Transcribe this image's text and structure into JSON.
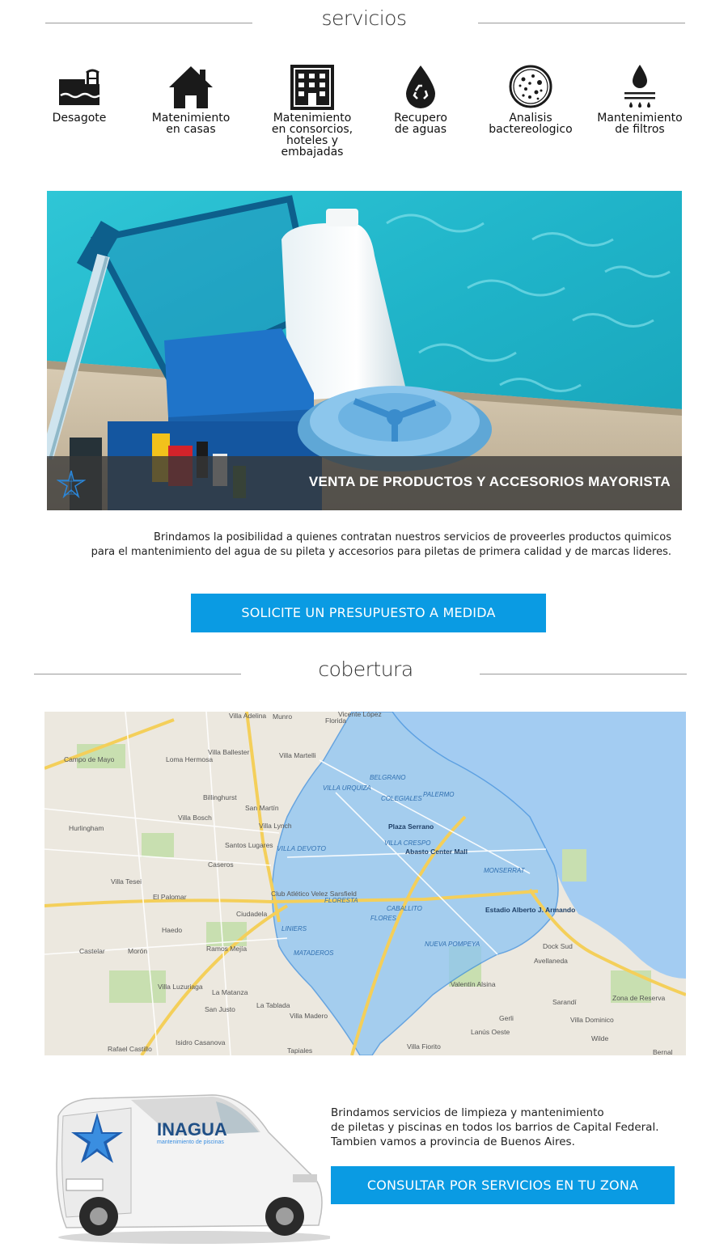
{
  "services_section": {
    "title": "servicios",
    "items": [
      {
        "icon": "pool-drain-icon",
        "line1": "Desagote",
        "line2": "",
        "line3": "",
        "line4": ""
      },
      {
        "icon": "house-icon",
        "line1": "Matenimiento",
        "line2": "en casas",
        "line3": "",
        "line4": ""
      },
      {
        "icon": "building-icon",
        "line1": "Matenimiento",
        "line2": "en consorcios,",
        "line3": "hoteles y",
        "line4": "embajadas"
      },
      {
        "icon": "recycle-drop-icon",
        "line1": "Recupero",
        "line2": "de aguas",
        "line3": "",
        "line4": ""
      },
      {
        "icon": "bacteria-dish-icon",
        "line1": "Analisis",
        "line2": "bactereologico",
        "line3": "",
        "line4": ""
      },
      {
        "icon": "filter-drop-icon",
        "line1": "Mantenimiento",
        "line2": "de filtros",
        "line3": "",
        "line4": ""
      }
    ]
  },
  "hero": {
    "caption": "VENTA DE PRODUCTOS Y ACCESORIOS MAYORISTA"
  },
  "products": {
    "line1": "Brindamos la posibilidad a quienes contratan nuestros servicios de proveerles productos quimicos",
    "line2": "para el mantenimiento del agua de su pileta y accesorios para piletas de primera calidad y de marcas lideres.",
    "button": "SOLICITE UN PRESUPUESTO A MEDIDA"
  },
  "coverage_section": {
    "title": "cobertura"
  },
  "map": {
    "labels": {
      "florida": "Florida",
      "vicente_lopez": "Vicente López",
      "villa_adelina": "Villa Adelina",
      "munro": "Munro",
      "villa_ballester": "Villa Ballester",
      "villa_martelli": "Villa Martelli",
      "campo_de_mayo": "Campo de Mayo",
      "loma_hermosa": "Loma Hermosa",
      "billinghurst": "Billinghurst",
      "san_martin": "San Martín",
      "villa_bosch": "Villa Bosch",
      "villa_lynch": "Villa Lynch",
      "hurlingham": "Hurlingham",
      "santos_lugares": "Santos Lugares",
      "villa_devoto": "VILLA DEVOTO",
      "caseros": "Caseros",
      "villa_tesei": "Villa Tesei",
      "el_palomar": "El Palomar",
      "ciudadela": "Ciudadela",
      "haedo": "Haedo",
      "moron": "Morón",
      "castelar": "Castelar",
      "ramos_mejia": "Ramos Mejía",
      "villa_luzuriaga": "Villa Luzuriaga",
      "la_matanza": "La Matanza",
      "san_justo": "San Justo",
      "la_tablada": "La Tablada",
      "villa_madero": "Villa Madero",
      "isidro_casanova": "Isidro Casanova",
      "rafael_castillo": "Rafael Castillo",
      "tapiales": "Tapiales",
      "belgrano": "BELGRANO",
      "villa_urquiza": "VILLA URQUIZA",
      "colegiales": "COLEGIALES",
      "palermo": "PALERMO",
      "plaza_serrano": "Plaza Serrano",
      "villa_crespo": "VILLA CRESPO",
      "abasto": "Abasto Center Mall",
      "monserrat": "MONSERRAT",
      "floresta": "FLORESTA",
      "caballito": "CABALLITO",
      "flores": "FLORES",
      "liniers": "LINIERS",
      "mataderos": "MATADEROS",
      "nueva_pompeya": "NUEVA POMPEYA",
      "estadio": "Estadio Alberto J. Armando",
      "dock_sud": "Dock Sud",
      "avellaneda": "Avellaneda",
      "valentin_alsina": "Valentín Alsina",
      "gerli": "Gerli",
      "lanus_oeste": "Lanús Oeste",
      "sarandi": "Sarandí",
      "villa_dominico": "Villa Dominico",
      "wilde": "Wilde",
      "villa_fiorito": "Villa Fiorito",
      "bernal": "Bernal",
      "zona_de_reserva": "Zona de Reserva",
      "club_velez": "Club Atlético Velez Sarsfield"
    }
  },
  "coverage": {
    "line1": "Brindamos servicios de limpieza y mantenimiento",
    "line2": "de piletas y piscinas en todos los barrios de Capital Federal.",
    "line3": "Tambien vamos a provincia de Buenos Aires.",
    "button": "CONSULTAR POR SERVICIOS EN TU ZONA",
    "van_brand": "INAGUA",
    "van_tagline": "mantenimiento de piscinas"
  }
}
